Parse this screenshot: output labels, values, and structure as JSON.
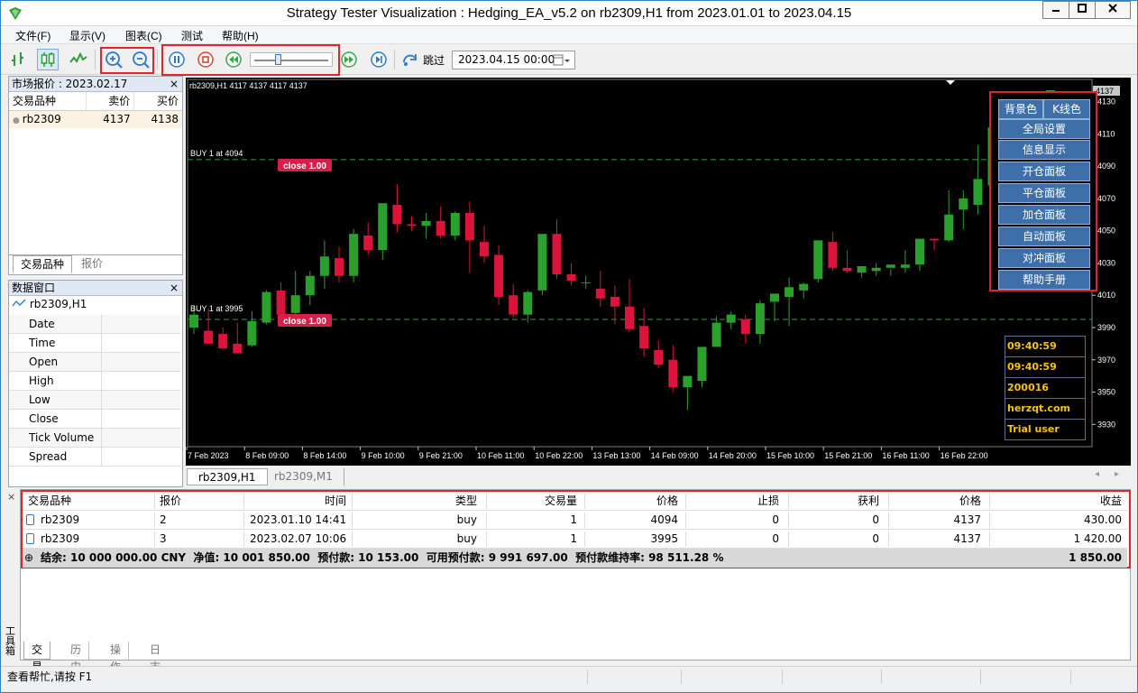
{
  "title": "Strategy Tester Visualization : Hedging_EA_v5.2 on rb2309,H1 from 2023.01.01 to 2023.04.15",
  "menu": [
    "文件(F)",
    "显示(V)",
    "图表(C)",
    "测试",
    "帮助(H)"
  ],
  "toolbar": {
    "skip_label": "跳过",
    "date_value": "2023.04.15 00:00",
    "slider_fraction": 0.3
  },
  "market": {
    "title": "市场报价 : 2023.02.17",
    "col_symbol": "交易品种",
    "col_bid": "卖价",
    "col_ask": "买价",
    "rows": [
      {
        "symbol": "rb2309",
        "bid": "4137",
        "ask": "4138"
      }
    ],
    "tab_symbols": "交易品种",
    "tab_quotes": "报价"
  },
  "datawin": {
    "title": "数据窗口",
    "symbol": "rb2309,H1",
    "fields": [
      "Date",
      "Time",
      "Open",
      "High",
      "Low",
      "Close",
      "Tick Volume",
      "Spread"
    ]
  },
  "chart": {
    "header": "rb2309,H1  4117 4137 4117 4137",
    "price_label": "4137",
    "buy_line_1": "BUY 1 at 4094",
    "buy_line_2": "BUY 1 at 3995",
    "close_label_1": "close 1.00",
    "close_label_2": "close 1.00",
    "buttons": [
      "背景色",
      "K线色",
      "全局设置",
      "信息显示",
      "开仓面板",
      "平仓面板",
      "加仓面板",
      "自动面板",
      "对冲面板",
      "帮助手册"
    ],
    "info": [
      "09:40:59",
      "09:40:59",
      "200016",
      "herzqt.com",
      "Trial user"
    ],
    "tab_h1": "rb2309,H1",
    "tab_m1": "rb2309,M1"
  },
  "chart_data": {
    "type": "candlestick",
    "y_ticks": [
      4130,
      4110,
      4090,
      4070,
      4050,
      4030,
      4010,
      3990,
      3970,
      3950,
      3930
    ],
    "ylim": [
      3919,
      4137
    ],
    "x_labels": [
      "7 Feb 2023",
      "8 Feb 09:00",
      "8 Feb 14:00",
      "9 Feb 10:00",
      "9 Feb 21:00",
      "10 Feb 11:00",
      "10 Feb 22:00",
      "13 Feb 13:00",
      "14 Feb 09:00",
      "14 Feb 20:00",
      "15 Feb 10:00",
      "15 Feb 21:00",
      "16 Feb 11:00",
      "16 Feb 22:00"
    ],
    "levels": [
      4094,
      3995
    ],
    "candles": [
      [
        3990,
        4004,
        3998,
        3986
      ],
      [
        3988,
        4002,
        3980,
        3985
      ],
      [
        3986,
        3990,
        3977,
        3980
      ],
      [
        3980,
        3993,
        3974,
        3979
      ],
      [
        3979,
        4000,
        3994,
        3978
      ],
      [
        3993,
        4013,
        4012,
        3992
      ],
      [
        4013,
        4018,
        3998,
        3999
      ],
      [
        3999,
        4025,
        4010,
        3997
      ],
      [
        4010,
        4025,
        4022,
        4004
      ],
      [
        4022,
        4044,
        4034,
        4014
      ],
      [
        4033,
        4040,
        4022,
        4018
      ],
      [
        4022,
        4051,
        4048,
        4018
      ],
      [
        4047,
        4055,
        4038,
        4035
      ],
      [
        4038,
        4067,
        4067,
        4032
      ],
      [
        4066,
        4079,
        4054,
        4049
      ],
      [
        4054,
        4059,
        4053,
        4050
      ],
      [
        4053,
        4061,
        4056,
        4045
      ],
      [
        4056,
        4065,
        4047,
        4045
      ],
      [
        4047,
        4062,
        4061,
        4044
      ],
      [
        4061,
        4068,
        4044,
        4024
      ],
      [
        4043,
        4053,
        4034,
        4030
      ],
      [
        4035,
        4041,
        4009,
        4004
      ],
      [
        4010,
        4017,
        3998,
        3996
      ],
      [
        3998,
        4013,
        4012,
        3993
      ],
      [
        4013,
        4036,
        4048,
        4010
      ],
      [
        4048,
        4057,
        4023,
        4020
      ],
      [
        4023,
        4030,
        4019,
        4016
      ],
      [
        4018,
        4022,
        4018,
        4014
      ],
      [
        4014,
        4025,
        4008,
        4003
      ],
      [
        4009,
        4016,
        4003,
        3992
      ],
      [
        4003,
        4020,
        3989,
        3987
      ],
      [
        3991,
        4002,
        3977,
        3972
      ],
      [
        3976,
        3982,
        3967,
        3965
      ],
      [
        3970,
        3979,
        3953,
        3950
      ],
      [
        3953,
        3959,
        3960,
        3939
      ],
      [
        3957,
        3961,
        3978,
        3953
      ],
      [
        3978,
        3997,
        3993,
        3978
      ],
      [
        3993,
        4000,
        3998,
        3989
      ],
      [
        3995,
        3998,
        3986,
        3980
      ],
      [
        3986,
        4007,
        4005,
        3980
      ],
      [
        4006,
        4011,
        4011,
        3994
      ],
      [
        4009,
        4021,
        4015,
        3991
      ],
      [
        4013,
        4018,
        4017,
        4008
      ],
      [
        4020,
        4032,
        4044,
        4018
      ],
      [
        4043,
        4049,
        4027,
        4025
      ],
      [
        4027,
        4038,
        4025,
        4024
      ],
      [
        4024,
        4026,
        4028,
        4021
      ],
      [
        4025,
        4030,
        4027,
        4022
      ],
      [
        4027,
        4026,
        4029,
        4022
      ],
      [
        4027,
        4038,
        4029,
        4024
      ],
      [
        4029,
        4040,
        4045,
        4025
      ],
      [
        4045,
        4045,
        4044,
        4038
      ],
      [
        4044,
        4075,
        4060,
        4043
      ],
      [
        4063,
        4075,
        4070,
        4051
      ],
      [
        4066,
        4103,
        4082,
        4060
      ],
      [
        4078,
        4117,
        4114,
        4072
      ],
      [
        4105,
        4122,
        4106,
        4090
      ],
      [
        4105,
        4130,
        4127,
        4101
      ],
      [
        4126,
        4127,
        4121,
        4108
      ],
      [
        4117,
        4137,
        4137,
        4115
      ]
    ]
  },
  "terminal": {
    "headers": [
      "交易品种",
      "报价",
      "时间",
      "类型",
      "交易量",
      "价格",
      "止损",
      "获利",
      "价格",
      "收益"
    ],
    "rows": [
      [
        "rb2309",
        "2",
        "2023.01.10 14:41:...",
        "buy",
        "1",
        "4094",
        "0",
        "0",
        "4137",
        "430.00"
      ],
      [
        "rb2309",
        "3",
        "2023.02.07 10:06:...",
        "buy",
        "1",
        "3995",
        "0",
        "0",
        "4137",
        "1 420.00"
      ]
    ],
    "summary": "结余: 10 000 000.00 CNY  净值: 10 001 850.00  预付款: 10 153.00  可用预付款: 9 991 697.00  预付款维持率: 98 511.28 %",
    "summary_total": "1 850.00",
    "tabs": [
      "交易",
      "历史",
      "操作",
      "日志"
    ],
    "side_label": "工具箱"
  },
  "status": "查看帮忙,请按 F1",
  "colors": {
    "bull": "#2ca02c",
    "bear": "#dc143c",
    "level": "#2f9e44",
    "button": "#3e6fa9",
    "info_text": "#f8c400",
    "highlight": "#e0262b"
  }
}
